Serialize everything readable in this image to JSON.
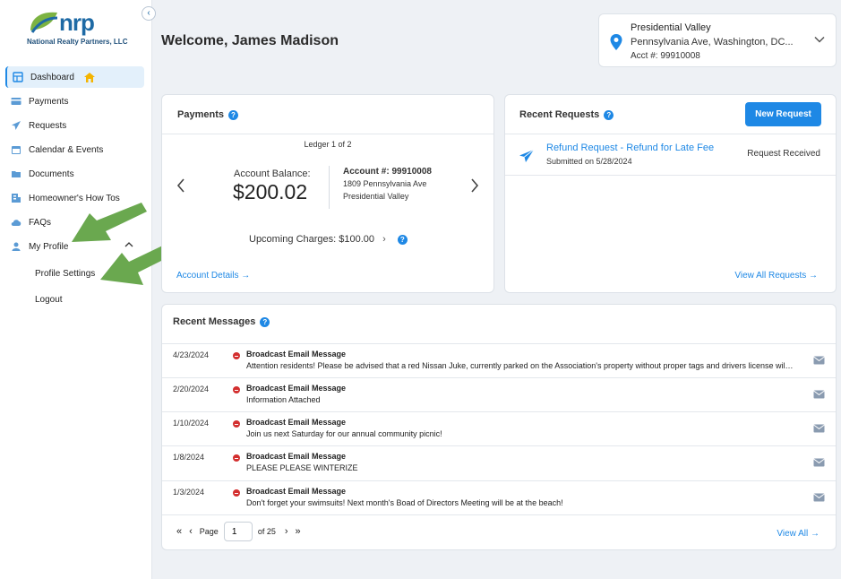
{
  "brand": {
    "logo_text": "nrp",
    "company": "National Realty Partners, LLC"
  },
  "sidebar": {
    "items": [
      {
        "label": "Dashboard"
      },
      {
        "label": "Payments"
      },
      {
        "label": "Requests"
      },
      {
        "label": "Calendar & Events"
      },
      {
        "label": "Documents"
      },
      {
        "label": "Homeowner's How Tos"
      },
      {
        "label": "FAQs"
      },
      {
        "label": "My Profile"
      }
    ],
    "profile_sub": {
      "settings": "Profile Settings",
      "logout": "Logout"
    }
  },
  "header": {
    "welcome": "Welcome, James Madison"
  },
  "property": {
    "name": "Presidential Valley",
    "address": "Pennsylvania Ave, Washington, DC...",
    "account": "Acct #: 99910008"
  },
  "payments": {
    "title": "Payments",
    "ledger": "Ledger 1 of 2",
    "balance_label": "Account Balance:",
    "balance_value": "$200.02",
    "account_label": "Account #: 99910008",
    "address_line1": "1809 Pennsylvania Ave",
    "address_line2": "Presidential Valley",
    "upcoming": "Upcoming Charges: $100.00",
    "account_details": "Account Details"
  },
  "requests": {
    "title": "Recent Requests",
    "new_button": "New Request",
    "item": {
      "title": "Refund Request - Refund for Late Fee",
      "date": "Submitted on 5/28/2024",
      "status": "Request Received"
    },
    "view_all": "View All Requests"
  },
  "messages": {
    "title": "Recent Messages",
    "rows": [
      {
        "date": "4/23/2024",
        "subject": "Broadcast Email Message",
        "body": "Attention residents! Please be advised that a red Nissan Juke, currently parked on the Association's property without proper tags and drivers license will be towed."
      },
      {
        "date": "2/20/2024",
        "subject": "Broadcast Email Message",
        "body": "Information Attached"
      },
      {
        "date": "1/10/2024",
        "subject": "Broadcast Email Message",
        "body": "Join us next Saturday for our annual community picnic!"
      },
      {
        "date": "1/8/2024",
        "subject": "Broadcast Email Message",
        "body": "PLEASE PLEASE WINTERIZE"
      },
      {
        "date": "1/3/2024",
        "subject": "Broadcast Email Message",
        "body": "Don't forget your swimsuits! Next month's Boad of Directors Meeting will be at the beach!"
      }
    ],
    "pager": {
      "page_label": "Page",
      "page_value": "1",
      "of_label": "of 25"
    },
    "view_all": "View All"
  },
  "colors": {
    "accent": "#1e88e5",
    "alert": "#d32f2f",
    "arrow": "#6aa84f"
  }
}
